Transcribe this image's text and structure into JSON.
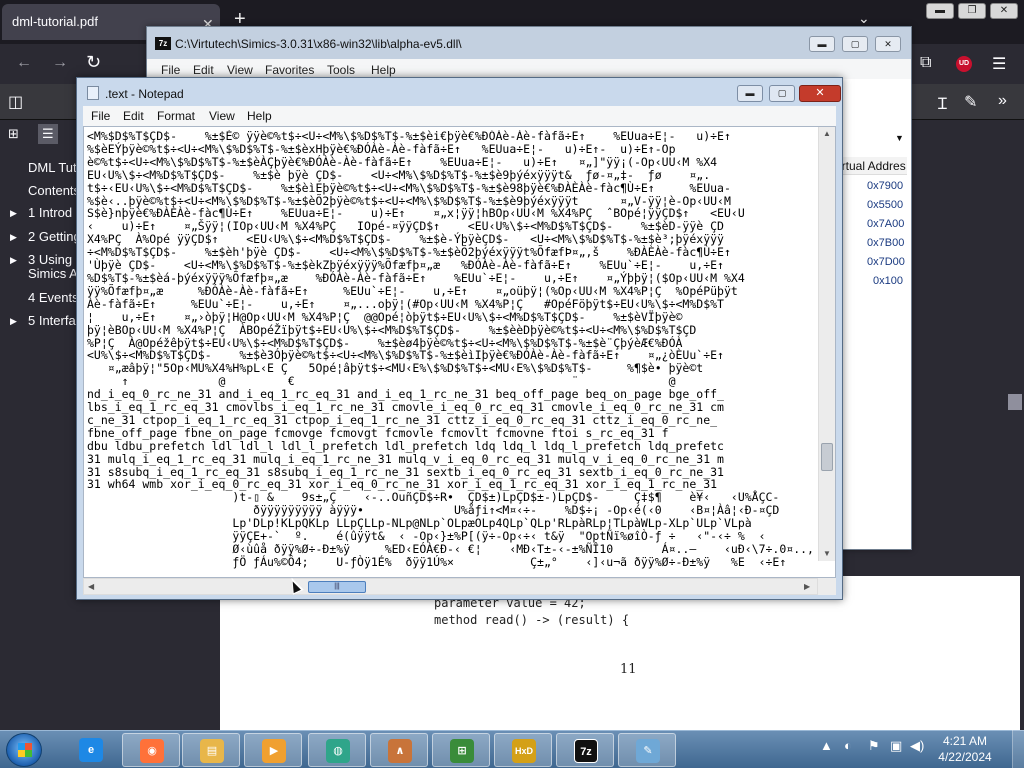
{
  "browser": {
    "tab_title": "dml-tutorial.pdf",
    "tab_close": "✕",
    "new_tab": "+",
    "tabs_chevron": "⌄",
    "sidebar_items": [
      {
        "label": "DML Tuto",
        "arrow": ""
      },
      {
        "label": "Contents",
        "arrow": ""
      },
      {
        "label": "1 Introd",
        "arrow": "▶"
      },
      {
        "label": "2 Getting",
        "arrow": "▶"
      },
      {
        "label": "3 Using",
        "arrow": "▶"
      },
      {
        "label": "Simics A",
        "arrow": ""
      },
      {
        "label": "4 Events",
        "arrow": ""
      },
      {
        "label": "5 Interfa",
        "arrow": "▶"
      }
    ],
    "pdf_lines": [
      "parameter value = 42;",
      "method read() -> (result) {"
    ],
    "page_number": "11"
  },
  "zip": {
    "title": "C:\\Virtutech\\Simics-3.0.31\\x86-win32\\lib\\alpha-ev5.dll\\",
    "title_icon": "7z",
    "menu": [
      "File",
      "Edit",
      "View",
      "Favorites",
      "Tools",
      "Help"
    ],
    "column_header": "irtual Addres",
    "addresses": [
      "0x7900",
      "0x5500",
      "0x7A00",
      "0x7B00",
      "0x7D00",
      "0x100"
    ]
  },
  "notepad": {
    "title": ".text - Notepad",
    "menu": [
      "File",
      "Edit",
      "Format",
      "View",
      "Help"
    ],
    "text": "<M%$D$%T$ÇD$-    %±$È© ÿÿè©%t$÷<U÷<M%\\$%D$%T$-%±$èi€þÿè€%ÐÓÀè-Àè-fàfã÷E↑    %EUua÷E¦-   u)÷E↑\n%$èEÝþÿè©%t$÷<U÷<M%\\$%D$%T$-%±$èxHþÿè€%ÐÓÀè-Àè-fàfã÷E↑   %EUua÷E¦-   u)÷E↑-  u)÷E↑-Op\nè©%t$÷<U÷<M%\\$%D$%T$-%±$èÀÇþÿè€%ÐÓÀè-Àè-fàfã÷E↑    %EUua÷E¦-   u)÷E↑   ¤„]\"ÿÿ¡(-Op‹UU‹M %X4\nEU‹U%\\$÷<M%D$%T$ÇD$-    %±$è þÿè ÇD$-    <U÷<M%\\$%D$%T$-%±$è9þýéxÿÿÿt&  ƒø-¤„‡-  ƒø    ¤„.\nt$÷‹EU‹U%\\$÷<M%D$%T$ÇD$-    %±$èìEþÿè©%t$÷<U÷<M%\\$%D$%T$-%±$è98þÿè€%ÐÀÈÀè-fàc¶Ù÷E↑     %EUua-\n%$è‹..þÿè©%t$÷<U÷<M%\\$%D$%T$-%±$èÕ2þÿè©%t$÷<U÷<M%\\$%D$%T$-%±$è9þýéxÿÿÿt      ¤„V-ÿÿ¦è-Op‹UU‹M\nS$è}nþÿè€%ÐÀÈÀè-fàc¶Ù÷E↑    %EUua÷E¦-    u)÷E↑    ¤„x¦ÿÿ¦hBOp‹UU‹M %X4%PÇ  ˆBOpé¦ÿÿÇD$↑   <EU‹U\n‹    u)÷E↑    ¤„Šÿÿ¦(IOp‹UU‹M %X4%PÇ   IOpé-¤ÿÿÇD$↑    <EU‹U%\\$÷<M%D$%T$ÇD$-    %±$èD-ÿÿè ÇD\nX4%PÇ  À%Opé ÿÿÇD$↑    <EU‹U%\\$÷<M%D$%T$ÇD$-    %±$è-ÝþÿèÇD$-   <U÷<M%\\$%D$%T$-%±$è³;þÿéxÿÿÿ\n÷<M%D$%T$ÇD$-    %±$èh'þÿè ÇD$-    <U÷<M%\\$%D$%T$-%±$èÕ2þýéxÿÿÿt%ÕfæfÞ¤„‚š    %ÐÀÈÀè-fàc¶Ù÷E↑\n'Ùþÿè ÇD$-    <U÷<M%\\$%D$%T$-%±$èkZþÿéxÿÿÿ%Õfæfþ¤„æ   %ÐÓÀè-Àè-fàfã÷E↑    %EUu`÷E¦-    u‚÷E↑\n%D$%T$-%±$èá-þýéxÿÿÿ%Õfæfþ¤„æ    %ÐÓÀè-Àè-fàfã÷E↑    %EUu`÷E¦-    u‚÷E↑    ¤„Ýþþÿ¦($Op‹UU‹M %X4\nÿÿ%Õfæfþ¤„æ     %ÐÓÀè-Àè-fàfã÷E↑     %EUu`÷E¦-    u‚÷E↑    ¤„oüþÿ¦(%Op‹UU‹M %X4%P¦Ç  %OpéPüþÿt\nÀè-fàfã÷E↑     %EUu`÷E¦-    u‚÷E↑    ¤„...oþÿ¦(#Op‹UU‹M %X4%P¦Ç   #OpéFöþÿt$÷EU‹U%\\$÷<M%D$%T\n¦    u‚÷E↑    ¤„›òþÿ¦H@Op‹UU‹M %X4%P¦Ç  @@Opé¦òþÿt$÷EU‹U%\\$÷<M%D$%T$ÇD$-    %±$èVÏþÿè©\nþÿ¦èBOp‹UU‹M %X4%P¦Ç  ÀBOpéŽïþÿt$÷EU‹U%\\$÷<M%D$%T$ÇD$-    %±$èèDþÿè©%t$÷<U÷<M%\\$%D$%T$ÇD\n%P¦Ç  À@Opéžêþÿt$÷EU‹U%\\$÷<M%D$%T$ÇD$-    %±$èø4þÿè©%t$÷<U÷<M%\\$%D$%T$-%±$è¨ÇþýèÆ€%ÐÓÀ\n<U%\\$÷<M%D$%T$ÇD$-    %±$è3Óþÿè©%t$÷<U÷<M%\\$%D$%T$-%±$èìIþÿè€%ÐÓÀè-Àè-fàfã÷E↑    ¤„¿òÈUu`÷E↑\n   ¤„æâþÿ¦\"5Op‹MU%X4%H%pL‹E Ç   5Opé¦âþÿt$÷<MU‹E%\\$%D$%T$÷<MU‹E%\\$%D$%T$-     %¶$è• þÿè©t\n     ↑             @         €                                        ¨             @\nnd_i_eq_0_rc_ne_31 and_i_eq_1_rc_eq_31 and_i_eq_1_rc_ne_31 beq_off_page beq_on_page bge_off_\nlbs_i_eq_1_rc_eq_31 cmovlbs_i_eq_1_rc_ne_31 cmovle_i_eq_0_rc_eq_31 cmovle_i_eq_0_rc_ne_31 cm\nc_ne_31 ctpop_i_eq_1_rc_eq_31 ctpop_i_eq_1_rc_ne_31 cttz_i_eq_0_rc_eq_31 cttz_i_eq_0_rc_ne_\nfbne_off_page fbne_on_page fcmovge fcmovgt fcmovle fcmovlt fcmovne ftoi s_rc_eq_31 f\ndbu ldbu_prefetch ldl ldl_l ldl_l_prefetch ldl_prefetch ldq ldq_l ldq_l_prefetch ldq_prefetc\n31 mulq_i_eq_1_rc_eq_31 mulq_i_eq_1_rc_ne_31 mulq_v_i_eq_0_rc_eq_31 mulq_v_i_eq_0_rc_ne_31 m\n31 s8subq_i_eq_1_rc_eq_31 s8subq_i_eq_1_rc_ne_31 sextb_i_eq_0_rc_eq_31 sextb_i_eq_0_rc_ne_31\n31 wh64 wmb xor_i_eq_0_rc_eq_31 xor_i_eq_0_rc_ne_31 xor_i_eq_1_rc_eq_31 xor_i_eq_1_rc_ne_31\n                     )t-▯ &    9s±„Ç    ‹-..OuñÇD$÷R•  ÇD$±)LpÇD$±-)LpÇD$-     Ç‡$¶    è¥‹   ‹U%ÅÇC-\n                        ðÿÿÿÿÿÿÿÿÿ àÿÿÿ•             U%åƒi↑<M¤‹÷-    %D$÷¡ -Op‹é(‹0    ‹B¤¦Àâ¦‹Ð-¤ÇD\n                     Lp'DLp!KLpQKLp LLpÇLLp-NLp@NLp`OLpæOLp4QLp`QLp'RLpàRLp¦TLpàWLp-XLp`ULp`VLpà\n                     ÿÿÇE+-`  º.    é(ûÿÿt&  ‹ -Op‹}±%P[(ÿ÷-Op‹÷‹ t&ÿ  \"OptÑï%øîÒ-ƒ ÷   ‹\"-‹÷ %  ‹\n                     Ø‹ùûå ðÿÿ%Ø÷-Ð±%ÿ     %ED‹EÓÀ€Ð-‹ €¦    ‹MÐ‹T±-‹-±%ÑÎ10       Á¤..–    ‹uÐ‹\\7÷.0¤..‚ \n                     ƒÖ ƒÁu%©Ô4;    U-ƒÒÿ1É%  ðÿÿ1Ú%×           Ç±„°    ‹]‹u¬ã ðÿÿ%Ø÷-Ð±%ÿ   %E  ‹÷E↑",
    "hscroll_grip": "|||"
  },
  "taskbar": {
    "apps": [
      {
        "name": "internet-explorer",
        "label": "e",
        "color": "#1e88e5"
      },
      {
        "name": "firefox",
        "label": "◉",
        "color": "#ff7139"
      },
      {
        "name": "file-explorer",
        "label": "▤",
        "color": "#e8b64a"
      },
      {
        "name": "media-player",
        "label": "▶",
        "color": "#f0a030"
      },
      {
        "name": "green-orb-app",
        "label": "◍",
        "color": "#2fa58a"
      },
      {
        "name": "matlab",
        "label": "∧",
        "color": "#c8743a"
      },
      {
        "name": "chart-app",
        "label": "⊞",
        "color": "#3a8c3a"
      },
      {
        "name": "hxd",
        "label": "HxD",
        "color": "#d4a017"
      },
      {
        "name": "7zip",
        "label": "7z",
        "color": "#111111"
      },
      {
        "name": "notepad",
        "label": "✎",
        "color": "#6fa8d6"
      }
    ],
    "tray_icons": [
      "▲",
      "◐",
      "⚑",
      "▣",
      "◀)"
    ],
    "time": "4:21 AM",
    "date": "4/22/2024"
  }
}
